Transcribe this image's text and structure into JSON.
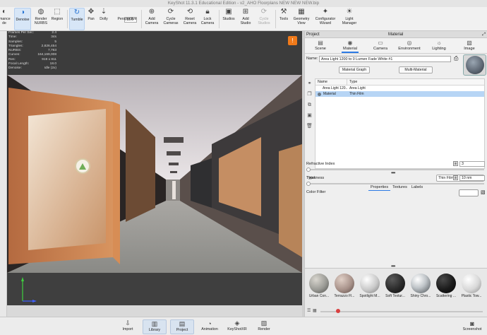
{
  "window_title": "KeyShot 11.3.1 Educational Edition - v2_AHO Floorplans NEW NEW NEW.bip",
  "toolbar": {
    "items": [
      {
        "id": "performance",
        "label": "rmance\nde"
      },
      {
        "id": "denoise",
        "label": "Denoise"
      },
      {
        "id": "render_nurbs",
        "label": "Render\nNURBS"
      },
      {
        "id": "region",
        "label": "Region"
      },
      {
        "id": "tumble",
        "label": "Tumble"
      },
      {
        "id": "pan",
        "label": "Pan"
      },
      {
        "id": "dolly",
        "label": "Dolly"
      },
      {
        "id": "perspective",
        "label": "Perspective"
      },
      {
        "id": "add_camera",
        "label": "Add\nCamera"
      },
      {
        "id": "cycle_cameras",
        "label": "Cycle\nCameras"
      },
      {
        "id": "reset_camera",
        "label": "Reset\nCamera"
      },
      {
        "id": "lock_camera",
        "label": "Lock\nCamera"
      },
      {
        "id": "studios",
        "label": "Studios"
      },
      {
        "id": "add_studio",
        "label": "Add\nStudio"
      },
      {
        "id": "cycle_studios",
        "label": "Cycle\nStudios"
      },
      {
        "id": "tools",
        "label": "Tools"
      },
      {
        "id": "geometry_view",
        "label": "Geometry\nView"
      },
      {
        "id": "configurator_wizard",
        "label": "Configurator\nWizard"
      },
      {
        "id": "light_manager",
        "label": "Light\nManager"
      }
    ],
    "fov_value": "18.0"
  },
  "stats": [
    {
      "label": "Frames Per Sec:",
      "value": "2.4"
    },
    {
      "label": "Time:",
      "value": "34s"
    },
    {
      "label": "Samples:",
      "value": "5"
    },
    {
      "label": "Triangles:",
      "value": "2,826,454"
    },
    {
      "label": "NURBS:",
      "value": "7,763"
    },
    {
      "label": "Curves:",
      "value": "164,169,008"
    },
    {
      "label": "Res:",
      "value": "919 x 811"
    },
    {
      "label": "Focal Length:",
      "value": "18.0"
    },
    {
      "label": "Denoise:",
      "value": "Idle (2x)"
    }
  ],
  "panel": {
    "left_title": "Project",
    "center_title": "Material",
    "tabs": [
      "Scene",
      "Material",
      "Camera",
      "Environment",
      "Lighting",
      "Image"
    ],
    "active_tab": "Material",
    "name_label": "Name:",
    "name_value": "Area Light 1200 to 0 Lumen Fade White #1",
    "material_graph_btn": "Material Graph",
    "multi_material_btn": "Multi-Material",
    "tree_headers": [
      "Name",
      "Type"
    ],
    "tree_rows": [
      {
        "name": "Area Light 120...",
        "type": "Area Light"
      },
      {
        "name": "Material",
        "type": "Thin Film"
      }
    ],
    "type_label": "Type:",
    "type_value": "Thin Film",
    "subtabs": [
      "Properties",
      "Textures",
      "Labels"
    ],
    "properties": [
      {
        "label": "Refractive Index",
        "value": "3"
      },
      {
        "label": "Thickness",
        "value": "10 nm"
      },
      {
        "label": "Color Filter",
        "value": ""
      }
    ]
  },
  "library": {
    "materials": [
      {
        "label": "Urban Con...",
        "color": "#9a9a95"
      },
      {
        "label": "Terrazzo Fl...",
        "color": "#a8928a"
      },
      {
        "label": "Spotlight M...",
        "color": "#c9c9c9"
      },
      {
        "label": "Soft Textur...",
        "color": "#2a2a2a"
      },
      {
        "label": "Shiny Chro...",
        "color": "#bfc4c8"
      },
      {
        "label": "Scattering ...",
        "color": "#1a1a1a"
      },
      {
        "label": "Plastic Tow...",
        "color": "#d8d8d8"
      }
    ]
  },
  "bottombar": {
    "items": [
      {
        "id": "import",
        "label": "Import"
      },
      {
        "id": "library",
        "label": "Library"
      },
      {
        "id": "project",
        "label": "Project"
      },
      {
        "id": "animation",
        "label": "Animation"
      },
      {
        "id": "keyshotxr",
        "label": "KeyShotXR"
      },
      {
        "id": "render",
        "label": "Render"
      },
      {
        "id": "screenshot",
        "label": "Screenshot"
      }
    ]
  },
  "colors": {
    "accent": "#2c7be5",
    "warning": "#f07a1a"
  }
}
